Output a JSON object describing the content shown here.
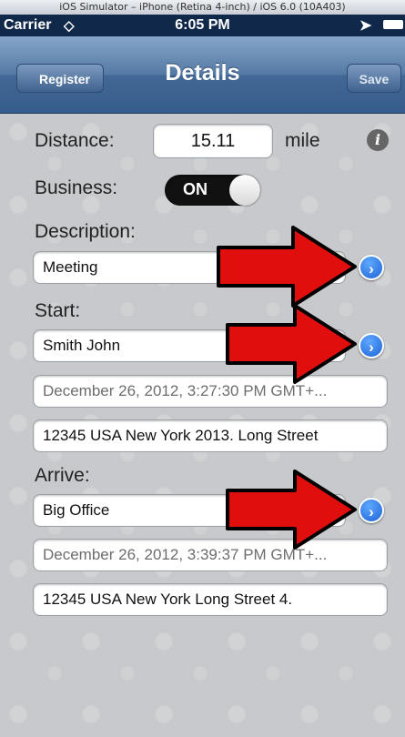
{
  "simulator": {
    "title": "iOS Simulator – iPhone (Retina 4-inch) / iOS 6.0 (10A403)"
  },
  "status": {
    "carrier": "Carrier",
    "time": "6:05 PM"
  },
  "nav": {
    "title": "Details",
    "back": "Register",
    "save": "Save"
  },
  "distance": {
    "label": "Distance:",
    "value": "15.11",
    "unit": "mile"
  },
  "business": {
    "label": "Business:",
    "toggle": "ON"
  },
  "description": {
    "label": "Description:",
    "value": "Meeting"
  },
  "start": {
    "label": "Start:",
    "name": "Smith John",
    "datetime": "December 26, 2012, 3:27:30 PM GMT+...",
    "address": "12345 USA New York 2013. Long Street"
  },
  "arrive": {
    "label": "Arrive:",
    "name": "Big Office",
    "datetime": "December 26, 2012, 3:39:37 PM GMT+...",
    "address": "12345 USA New York Long Street 4."
  },
  "icons": {
    "info": "info-icon",
    "disclosure": "chevron-right-circle-icon",
    "annotation": "red-arrow-icon"
  },
  "colors": {
    "nav": "#426896",
    "annotation_arrow": "#e10e0e",
    "disclosure": "#1d63d6"
  }
}
